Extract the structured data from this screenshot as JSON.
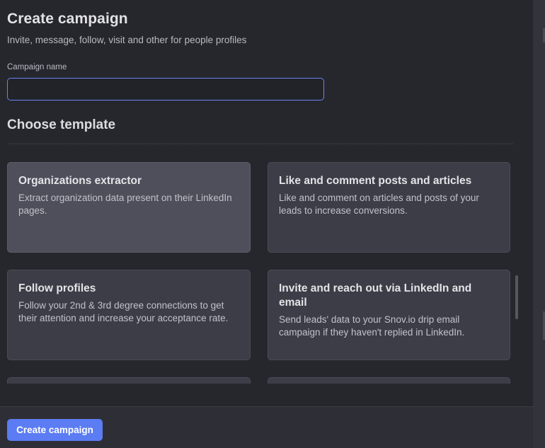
{
  "header": {
    "title": "Create campaign",
    "subtitle": "Invite, message, follow, visit and other for people profiles"
  },
  "form": {
    "campaign_name_label": "Campaign name",
    "campaign_name_value": "",
    "campaign_name_placeholder": ""
  },
  "templates": {
    "section_title": "Choose template",
    "items": [
      {
        "title": "Organizations extractor",
        "description": "Extract organization data present on their LinkedIn pages.",
        "selected": true
      },
      {
        "title": "Like and comment posts and articles",
        "description": "Like and comment on articles and posts of your leads to increase conversions.",
        "selected": false
      },
      {
        "title": "Follow profiles",
        "description": "Follow your 2nd & 3rd degree connections to get their attention and increase your acceptance rate.",
        "selected": false
      },
      {
        "title": "Invite and reach out via LinkedIn and email",
        "description": "Send leads' data to your Snov.io drip email campaign if they haven't replied in LinkedIn.",
        "selected": false
      }
    ]
  },
  "footer": {
    "create_button_label": "Create campaign"
  },
  "colors": {
    "background": "#26272d",
    "card": "#3c3d47",
    "card_selected": "#4e4f5a",
    "accent": "#5b7cf3",
    "input_focus_border": "#6c82f2"
  }
}
